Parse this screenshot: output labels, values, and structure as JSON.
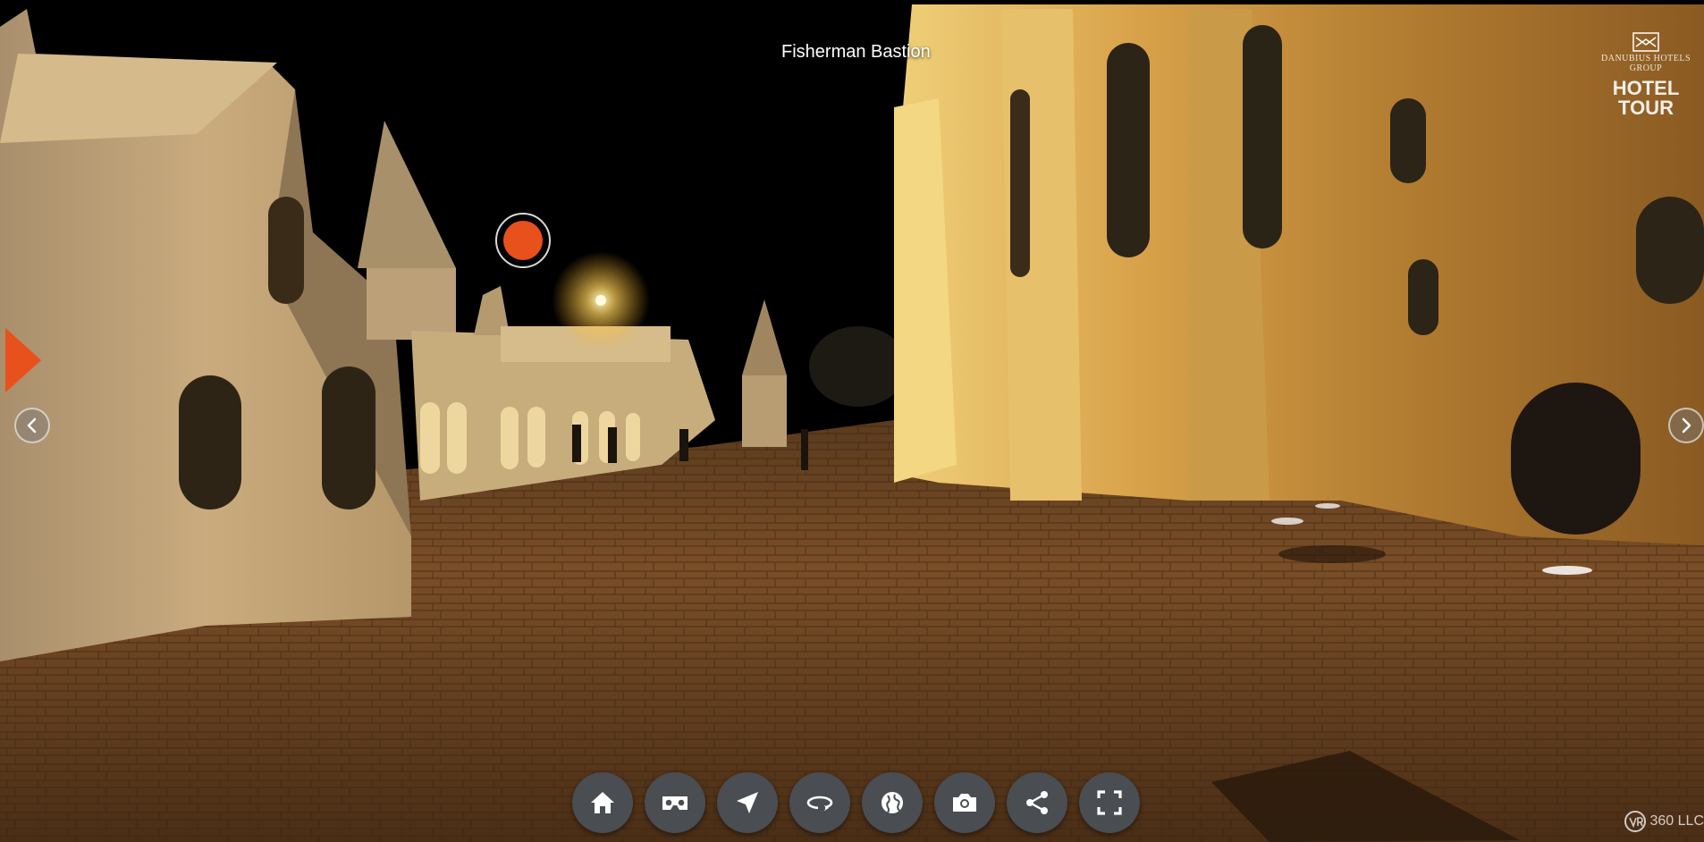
{
  "scene": {
    "title": "Fisherman Bastion"
  },
  "brand": {
    "group_line1": "DANUBIUS HOTELS",
    "group_line2": "GROUP",
    "product": "HOTEL TOUR",
    "icon": "danubius-logo-icon"
  },
  "hotspot": {
    "icon": "hotspot-marker-icon",
    "color": "#e8501c"
  },
  "side_panel": {
    "icon": "play-triangle-icon",
    "color": "#e8501c"
  },
  "navigation": {
    "previous_icon": "chevron-left-icon",
    "next_icon": "chevron-right-icon"
  },
  "toolbar": {
    "buttons": [
      {
        "name": "home",
        "icon": "home-icon"
      },
      {
        "name": "vr",
        "icon": "vr-headset-icon"
      },
      {
        "name": "navigate",
        "icon": "navigation-arrow-icon"
      },
      {
        "name": "autorotate",
        "icon": "rotate-icon"
      },
      {
        "name": "map",
        "icon": "globe-icon"
      },
      {
        "name": "snapshot",
        "icon": "camera-icon"
      },
      {
        "name": "share",
        "icon": "share-icon"
      },
      {
        "name": "fullscreen",
        "icon": "fullscreen-icon"
      }
    ],
    "button_color": "#4a4d52",
    "icon_color": "#ffffff"
  },
  "credit": {
    "label": "360 LLC",
    "icon": "vr360-logo-icon"
  },
  "colors": {
    "accent": "#e8501c",
    "sky": "#000000",
    "stone_lit": "#d8a24a",
    "pavement": "#6b4524"
  }
}
